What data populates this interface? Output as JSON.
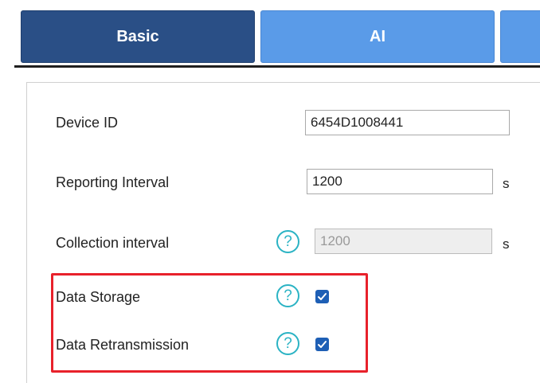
{
  "tabs": [
    {
      "label": "Basic",
      "active": true
    },
    {
      "label": "AI",
      "active": false
    },
    {
      "label": "",
      "active": false
    }
  ],
  "colors": {
    "tab_active": "#2a4f86",
    "tab_inactive": "#5a9be8",
    "help_icon": "#2bb3c4",
    "checkbox": "#1e5fb5",
    "highlight": "#e8212b"
  },
  "form": {
    "device_id": {
      "label": "Device ID",
      "value": "6454D1008441"
    },
    "reporting_interval": {
      "label": "Reporting Interval",
      "value": "1200",
      "unit": "s"
    },
    "collection_interval": {
      "label": "Collection interval",
      "value": "1200",
      "unit": "s",
      "disabled": true,
      "help_icon": "question-circle-icon"
    },
    "data_storage": {
      "label": "Data Storage",
      "checked": true,
      "help_icon": "question-circle-icon"
    },
    "data_retransmission": {
      "label": "Data Retransmission",
      "checked": true,
      "help_icon": "question-circle-icon"
    }
  },
  "help_glyph": "?"
}
